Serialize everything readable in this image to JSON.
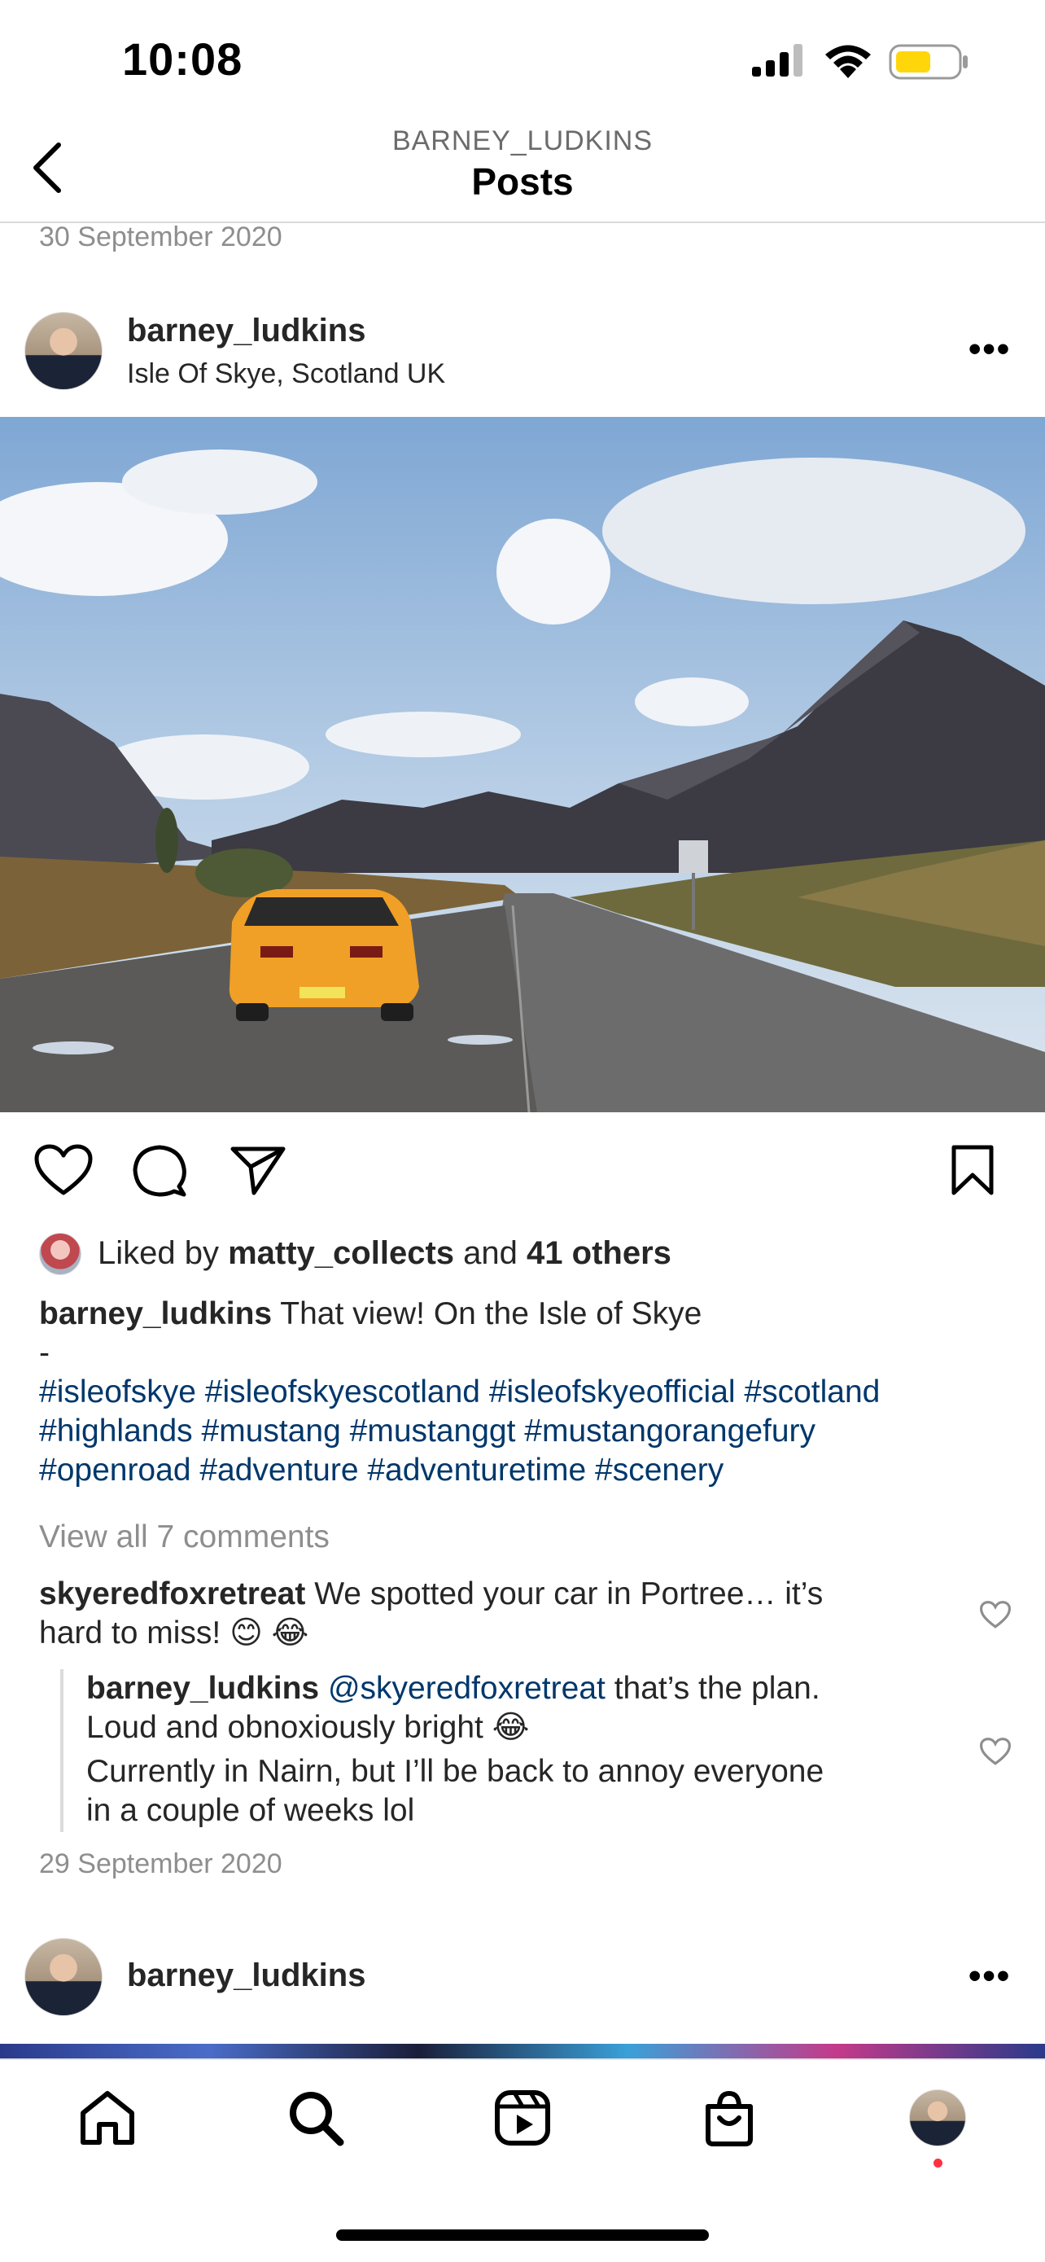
{
  "status_bar": {
    "time": "10:08"
  },
  "header": {
    "username": "BARNEY_LUDKINS",
    "title": "Posts"
  },
  "post_prev_date": "30 September 2020",
  "post": {
    "username": "barney_ludkins",
    "location": "Isle Of Skye, Scotland UK",
    "more_label": "•••",
    "likes": {
      "prefix": "Liked by",
      "liker": "matty_collects",
      "and": "and",
      "others": "41 others"
    },
    "caption": {
      "username": "barney_ludkins",
      "text": "That view! On the Isle of Skye",
      "separator": "-",
      "hashtags_line1": [
        "#isleofskye",
        "#isleofskyescotland",
        "#isleofskyeofficial",
        "#scotland"
      ],
      "hashtags_line2": [
        "#highlands",
        "#mustang",
        "#mustanggt",
        "#mustangorangefury"
      ],
      "hashtags_line3": [
        "#openroad",
        "#adventure",
        "#adventuretime",
        "#scenery"
      ]
    },
    "view_comments": "View all 7 comments",
    "comments": [
      {
        "username": "skyeredfoxretreat",
        "text_line1": "We spotted your car in Portree… it’s",
        "text_line2": "hard to miss! 😊 😂"
      }
    ],
    "reply": {
      "username": "barney_ludkins",
      "mention": "@skyeredfoxretreat",
      "text_line1": "that’s the plan.",
      "text_line2": "Loud and obnoxiously bright 😂",
      "text_line3": "Currently in Nairn, but I’ll be back to annoy everyone",
      "text_line4": "in a couple of weeks lol"
    },
    "date": "29 September 2020"
  },
  "next_post": {
    "username": "barney_ludkins",
    "more_label": "•••"
  },
  "tab_bar": {
    "items": [
      {
        "icon": "home-icon"
      },
      {
        "icon": "search-icon"
      },
      {
        "icon": "reels-icon"
      },
      {
        "icon": "shop-icon"
      },
      {
        "icon": "profile-avatar"
      }
    ],
    "notification_color": "#ff3040"
  },
  "colors": {
    "hashtag": "#00376b",
    "battery": "#ffd60a"
  }
}
